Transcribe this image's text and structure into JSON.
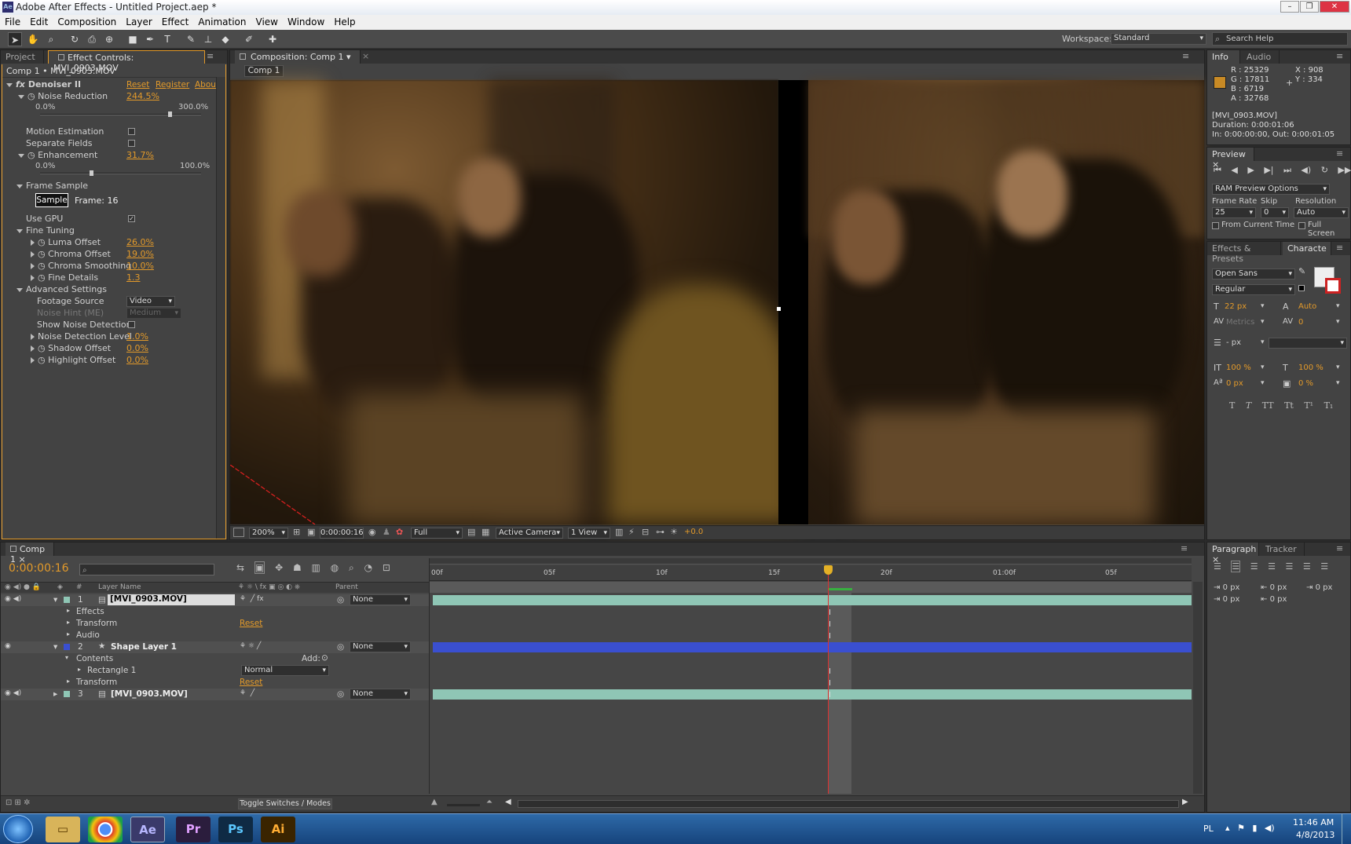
{
  "window": {
    "title": "Adobe After Effects - Untitled Project.aep *",
    "app_icon": "Ae"
  },
  "menu": [
    "File",
    "Edit",
    "Composition",
    "Layer",
    "Effect",
    "Animation",
    "View",
    "Window",
    "Help"
  ],
  "toolbar": {
    "workspace_label": "Workspace:",
    "workspace_value": "Standard",
    "search_help": "Search Help"
  },
  "left_panel": {
    "tabs": [
      "Project",
      "Effect Controls: MVI_0903.MOV"
    ],
    "breadcrumb": "Comp 1 • MVI_0903.MOV",
    "effect": {
      "name": "Denoiser II",
      "reset": "Reset",
      "register": "Register",
      "about": "About"
    },
    "noise_reduction": {
      "label": "Noise Reduction",
      "value": "244.5%",
      "min": "0.0%",
      "max": "300.0%",
      "fraction": 0.815
    },
    "motion_estimation": "Motion Estimation",
    "separate_fields": "Separate Fields",
    "enhancement": {
      "label": "Enhancement",
      "value": "31.7%",
      "min": "0.0%",
      "max": "100.0%",
      "fraction": 0.317
    },
    "frame_sample": {
      "label": "Frame Sample",
      "button": "Sample",
      "frame": "Frame: 16"
    },
    "use_gpu": "Use GPU",
    "fine_tuning": {
      "label": "Fine Tuning",
      "items": [
        {
          "label": "Luma Offset",
          "value": "26.0%"
        },
        {
          "label": "Chroma Offset",
          "value": "19.0%"
        },
        {
          "label": "Chroma Smoothing",
          "value": "10.0%"
        },
        {
          "label": "Fine Details",
          "value": "1.3"
        }
      ]
    },
    "advanced": {
      "label": "Advanced Settings",
      "footage_source": {
        "label": "Footage Source",
        "value": "Video"
      },
      "noise_hint": {
        "label": "Noise Hint (ME)",
        "value": "Medium"
      },
      "show_noise": "Show Noise Detection",
      "items": [
        {
          "label": "Noise Detection Level",
          "value": "1.0%"
        },
        {
          "label": "Shadow Offset",
          "value": "0.0%"
        },
        {
          "label": "Highlight Offset",
          "value": "0.0%"
        }
      ]
    }
  },
  "composition": {
    "tab": "Composition: Comp 1",
    "subtab": "Comp 1",
    "footer": {
      "zoom": "200%",
      "timecode": "0:00:00:16",
      "resolution": "Full",
      "camera": "Active Camera",
      "views": "1 View",
      "exposure": "+0.0"
    }
  },
  "info_panel": {
    "tabs": [
      "Info",
      "Audio"
    ],
    "r": "R : 25329",
    "g": "G : 17811",
    "b": "B : 6719",
    "a": "A : 32768",
    "x": "X : 908",
    "y": "Y : 334",
    "file": "[MVI_0903.MOV]",
    "duration": "Duration: 0:00:01:06",
    "inout": "In: 0:00:00:00, Out: 0:00:01:05",
    "swatch_color": "#c88a25"
  },
  "preview_panel": {
    "tab": "Preview",
    "ram": "RAM Preview Options",
    "frame_rate_label": "Frame Rate",
    "skip_label": "Skip",
    "resolution_label": "Resolution",
    "frame_rate": "25",
    "skip": "0",
    "resolution": "Auto",
    "from_current": "From Current Time",
    "full_screen": "Full Screen"
  },
  "character_panel": {
    "tabs": [
      "Effects & Presets",
      "Characte"
    ],
    "font": "Open Sans",
    "style": "Regular",
    "size": "22 px",
    "leading": "Auto",
    "kerning": "Metrics",
    "tracking": "0",
    "stroke": "- px",
    "vscale": "100 %",
    "hscale": "100 %",
    "baseline": "0 px",
    "tsume": "0 %",
    "styles": [
      "T",
      "T",
      "TT",
      "Tt",
      "T¹",
      "T₁"
    ]
  },
  "timeline": {
    "tab": "Comp 1",
    "timecode": "0:00:00:16",
    "columns": {
      "num": "#",
      "layer_name": "Layer Name",
      "parent": "Parent"
    },
    "ruler": [
      "00f",
      "05f",
      "10f",
      "15f",
      "20f",
      "01:00f",
      "05f"
    ],
    "layers": [
      {
        "num": "1",
        "name": "[MVI_0903.MOV]",
        "parent": "None"
      },
      {
        "name": "Effects"
      },
      {
        "name": "Transform",
        "value": "Reset"
      },
      {
        "name": "Audio"
      },
      {
        "num": "2",
        "name": "Shape Layer 1",
        "parent": "None"
      },
      {
        "name": "Contents",
        "add": "Add:"
      },
      {
        "name": "Rectangle 1",
        "mode": "Normal"
      },
      {
        "name": "Transform",
        "value": "Reset"
      },
      {
        "num": "3",
        "name": "[MVI_0903.MOV]",
        "parent": "None"
      }
    ],
    "toggle": "Toggle Switches / Modes",
    "colors": {
      "footage": "#8fc6b5",
      "shape": "#3a4fd0",
      "playhead": "#e03030"
    }
  },
  "paragraph_panel": {
    "tabs": [
      "Paragraph",
      "Tracker"
    ],
    "indent_values": [
      "0 px",
      "0 px",
      "0 px",
      "0 px",
      "0 px"
    ]
  },
  "taskbar": {
    "lang": "PL",
    "time": "11:46 AM",
    "date": "4/8/2013",
    "apps": [
      "Ae",
      "Pr",
      "Ps",
      "Ai"
    ]
  }
}
